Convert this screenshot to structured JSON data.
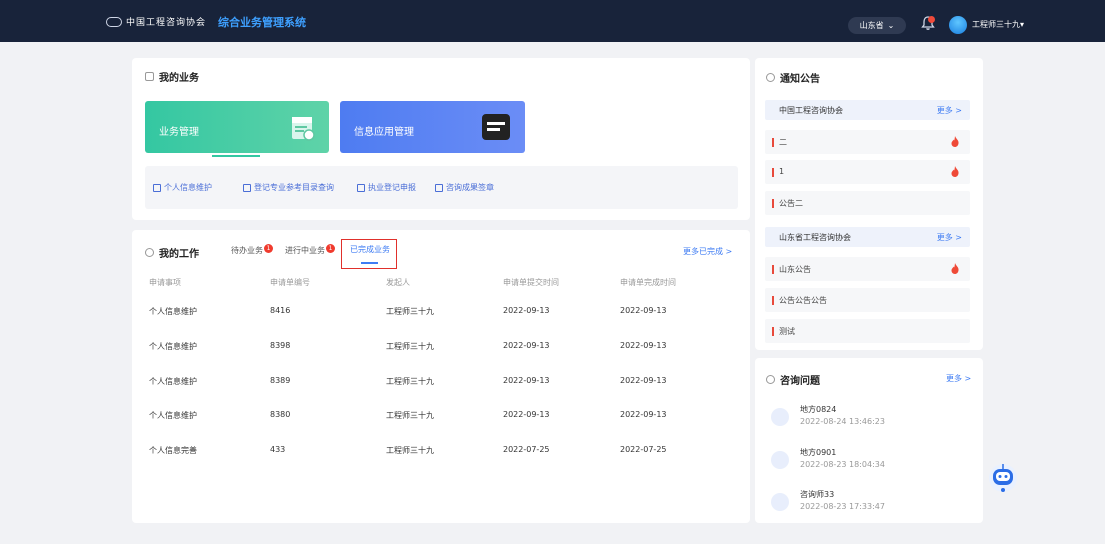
{
  "header": {
    "logo_text": "中国工程咨询协会",
    "system_title": "综合业务管理系统",
    "region": "山东省",
    "username": "工程师三十九",
    "colors": {
      "topbar": "#18233a",
      "title": "#3ea0ff"
    }
  },
  "my_business": {
    "title": "我的业务",
    "tiles": [
      {
        "label": "业务管理"
      },
      {
        "label": "信息应用管理"
      }
    ],
    "shortcuts": [
      {
        "label": "个人信息维护"
      },
      {
        "label": "登记专业参考目录查询"
      },
      {
        "label": "执业登记申报"
      },
      {
        "label": "咨询成果签章"
      }
    ]
  },
  "my_work": {
    "title": "我的工作",
    "tabs": [
      {
        "label": "待办业务",
        "badge": "1"
      },
      {
        "label": "进行中业务",
        "badge": "1"
      },
      {
        "label": "已完成业务"
      }
    ],
    "more": "更多已完成 >",
    "columns": [
      "申请事项",
      "申请单编号",
      "发起人",
      "申请单提交时间",
      "申请单完成时间"
    ],
    "rows": [
      [
        "个人信息维护",
        "8416",
        "工程师三十九",
        "2022-09-13",
        "2022-09-13"
      ],
      [
        "个人信息维护",
        "8398",
        "工程师三十九",
        "2022-09-13",
        "2022-09-13"
      ],
      [
        "个人信息维护",
        "8389",
        "工程师三十九",
        "2022-09-13",
        "2022-09-13"
      ],
      [
        "个人信息维护",
        "8380",
        "工程师三十九",
        "2022-09-13",
        "2022-09-13"
      ],
      [
        "个人信息完善",
        "433",
        "工程师三十九",
        "2022-07-25",
        "2022-07-25"
      ]
    ]
  },
  "notices": {
    "title": "通知公告",
    "groups": [
      {
        "name": "中国工程咨询协会",
        "more": "更多 >",
        "items": [
          {
            "text": "二",
            "hot": true
          },
          {
            "text": "1",
            "hot": true
          },
          {
            "text": "公告二",
            "hot": false
          }
        ]
      },
      {
        "name": "山东省工程咨询协会",
        "more": "更多 >",
        "items": [
          {
            "text": "山东公告",
            "hot": true
          },
          {
            "text": "公告公告公告",
            "hot": false
          },
          {
            "text": "测试",
            "hot": false
          }
        ]
      }
    ]
  },
  "questions": {
    "title": "咨询问题",
    "more": "更多 >",
    "items": [
      {
        "title": "地方0824",
        "time": "2022-08-24 13:46:23"
      },
      {
        "title": "地方0901",
        "time": "2022-08-23 18:04:34"
      },
      {
        "title": "咨询师33",
        "time": "2022-08-23 17:33:47"
      }
    ]
  }
}
